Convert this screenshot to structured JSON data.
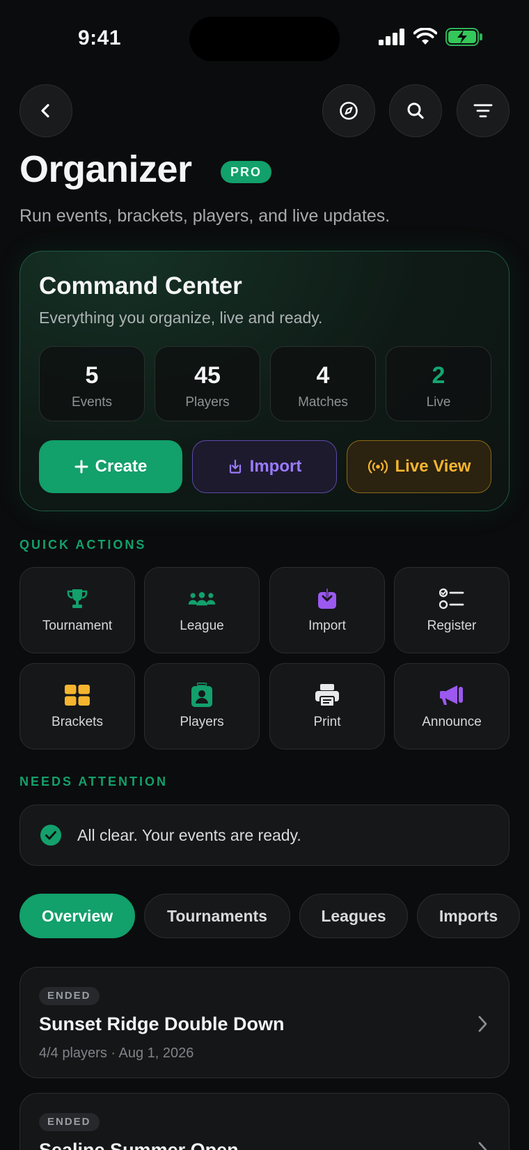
{
  "status_bar": {
    "time": "9:41"
  },
  "header": {
    "title": "Organizer",
    "badge": "PRO",
    "subtitle": "Run events, brackets, players, and live updates."
  },
  "command_center": {
    "title": "Command Center",
    "subtitle": "Everything you organize, live and ready.",
    "stats": [
      {
        "value": "5",
        "label": "Events"
      },
      {
        "value": "45",
        "label": "Players"
      },
      {
        "value": "4",
        "label": "Matches"
      },
      {
        "value": "2",
        "label": "Live"
      }
    ],
    "buttons": {
      "create": "Create",
      "import": "Import",
      "live_view": "Live View"
    }
  },
  "quick_actions": {
    "label": "QUICK ACTIONS",
    "items": [
      {
        "label": "Tournament",
        "icon": "trophy-icon",
        "color": "#13a06c"
      },
      {
        "label": "League",
        "icon": "people-icon",
        "color": "#13a06c"
      },
      {
        "label": "Import",
        "icon": "import-icon",
        "color": "#9b59f0"
      },
      {
        "label": "Register",
        "icon": "checklist-icon",
        "color": "#e8e9ea"
      },
      {
        "label": "Brackets",
        "icon": "grid-icon",
        "color": "#f5b52e"
      },
      {
        "label": "Players",
        "icon": "id-badge-icon",
        "color": "#13a06c"
      },
      {
        "label": "Print",
        "icon": "printer-icon",
        "color": "#e8e9ea"
      },
      {
        "label": "Announce",
        "icon": "megaphone-icon",
        "color": "#9b59f0"
      }
    ]
  },
  "attention": {
    "label": "NEEDS ATTENTION",
    "message": "All clear. Your events are ready."
  },
  "tabs": [
    {
      "label": "Overview",
      "active": true
    },
    {
      "label": "Tournaments",
      "active": false
    },
    {
      "label": "Leagues",
      "active": false
    },
    {
      "label": "Imports",
      "active": false
    }
  ],
  "events": [
    {
      "status": "ENDED",
      "name": "Sunset Ridge Double Down",
      "meta": "4/4 players · Aug 1, 2026"
    },
    {
      "status": "ENDED",
      "name": "Sealine Summer Open",
      "meta": ""
    }
  ],
  "colors": {
    "accent": "#12a06b",
    "import": "#9b7bff",
    "live": "#f5b52e",
    "background": "#0b0c0d"
  }
}
